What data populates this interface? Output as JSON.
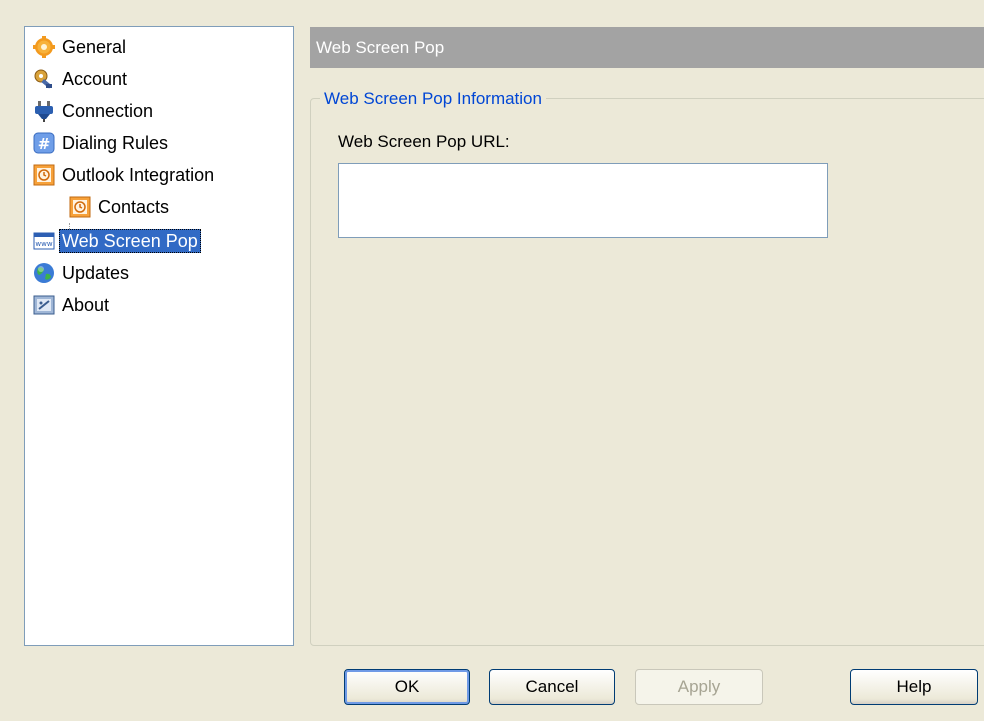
{
  "tree": {
    "items": [
      {
        "label": "General",
        "icon": "gear-icon"
      },
      {
        "label": "Account",
        "icon": "key-icon"
      },
      {
        "label": "Connection",
        "icon": "plug-icon"
      },
      {
        "label": "Dialing Rules",
        "icon": "hash-icon"
      },
      {
        "label": "Outlook Integration",
        "icon": "clock-icon"
      },
      {
        "label": "Contacts",
        "icon": "clock-icon"
      },
      {
        "label": "Web Screen Pop",
        "icon": "www-icon"
      },
      {
        "label": "Updates",
        "icon": "globe-icon"
      },
      {
        "label": "About",
        "icon": "about-icon"
      }
    ],
    "selected": "Web Screen Pop"
  },
  "panel": {
    "header": "Web Screen Pop",
    "group_title": "Web Screen Pop Information",
    "url_label": "Web Screen Pop URL:",
    "url_value": ""
  },
  "buttons": {
    "ok": "OK",
    "cancel": "Cancel",
    "apply": "Apply",
    "help": "Help"
  },
  "colors": {
    "dialog_bg": "#ece9d8",
    "selection": "#316ac5",
    "header_bg": "#a3a3a3",
    "group_title": "#0046d5"
  }
}
